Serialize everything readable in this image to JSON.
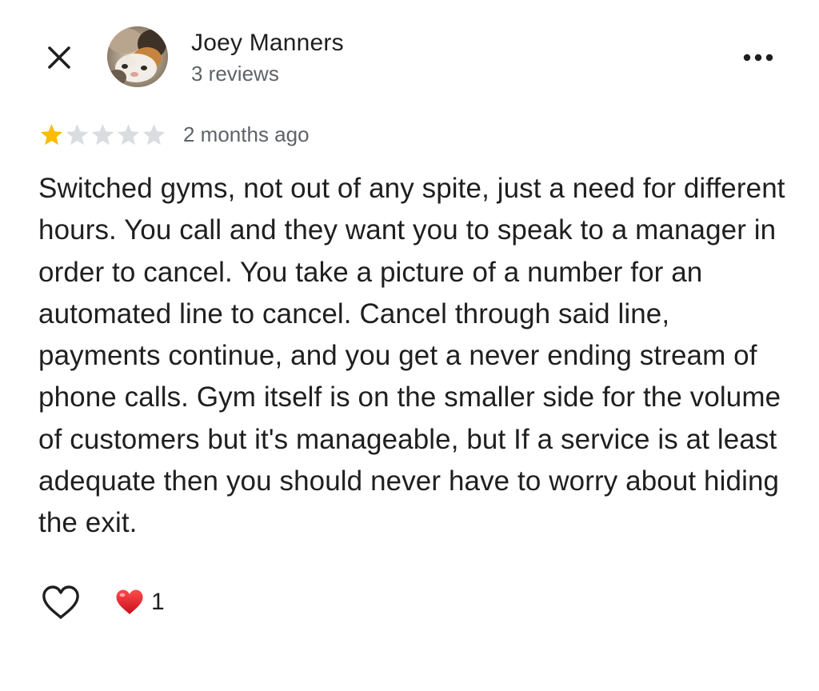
{
  "header": {
    "close_icon": "close-icon",
    "more_icon": "more-horizontal-icon"
  },
  "reviewer": {
    "name": "Joey Manners",
    "review_count": "3 reviews",
    "avatar": "cat-photo-avatar"
  },
  "review": {
    "rating": 1,
    "max_rating": 5,
    "star_filled_color": "#fbbc04",
    "star_empty_color": "#dadce0",
    "time_ago": "2 months ago",
    "text": "Switched gyms, not out of any spite, just a need for different hours. You call and they want you to speak to a manager in order to cancel. You take a picture of a number for an automated line to cancel. Cancel through said line, payments continue, and you get a never ending stream of phone calls. Gym itself is on the smaller side for the volume of customers but it's manageable, but If a service is at least adequate then you should never have to worry about hiding the exit."
  },
  "actions": {
    "like_icon": "heart-outline-icon",
    "reaction_icon": "red-heart-icon",
    "reaction_count": "1",
    "reaction_color": "#e0242b"
  }
}
